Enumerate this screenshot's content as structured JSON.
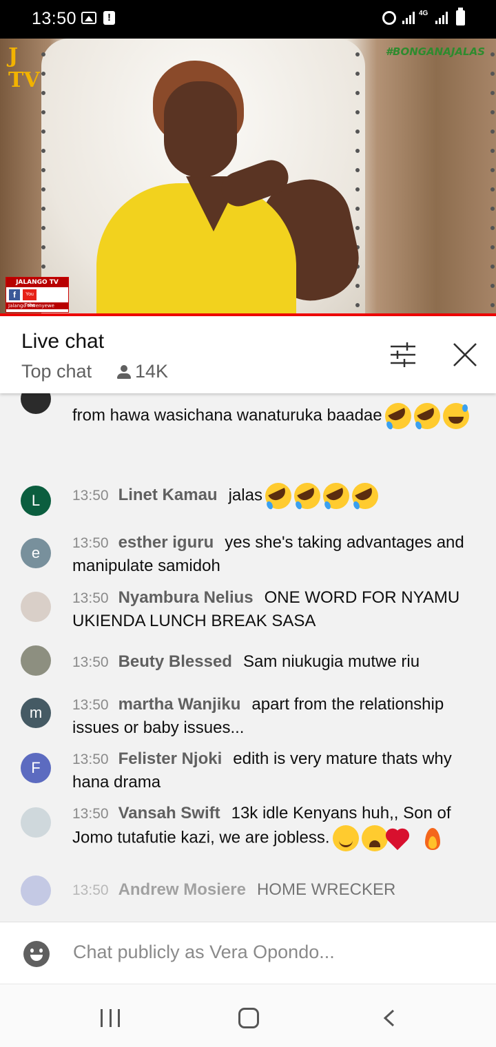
{
  "status_bar": {
    "time": "13:50",
    "network": "4G",
    "icons": [
      "image-icon",
      "alert-icon",
      "alarm-icon",
      "signal-icon",
      "battery-icon"
    ]
  },
  "video": {
    "hashtag": "#BONGANAJALAS",
    "channel_logo": "J TV",
    "badge_top": "JALANGO TV",
    "badge_bottom": "Jalango Mwenyewe",
    "badge_yt": "You Tube",
    "badge_fb": "f",
    "progress_fraction": 1.0,
    "progress_color": "#ee0000"
  },
  "chat_header": {
    "title": "Live chat",
    "mode": "Top chat",
    "viewer_count": "14K"
  },
  "messages": [
    {
      "time": "",
      "author": "",
      "text": "from hawa wasichana wanaturuka baadae",
      "emojis": [
        "rofl",
        "rofl",
        "sweat"
      ],
      "avatar_letter": "",
      "avatar_color": "#2b2b2b"
    },
    {
      "time": "13:50",
      "author": "Linet Kamau",
      "text": "jalas",
      "emojis": [
        "rofl",
        "rofl",
        "rofl",
        "rofl"
      ],
      "avatar_letter": "L",
      "avatar_color": "#0b5e3f"
    },
    {
      "time": "13:50",
      "author": "esther iguru",
      "text": "yes she's taking advantages and manipulate samidoh",
      "emojis": [],
      "avatar_letter": "e",
      "avatar_color": "#78909c"
    },
    {
      "time": "13:50",
      "author": "Nyambura Nelius",
      "text": "ONE WORD FOR NYAMU UKIENDA LUNCH BREAK SASA",
      "emojis": [],
      "avatar_letter": "",
      "avatar_color": "#d9cfc8"
    },
    {
      "time": "13:50",
      "author": "Beuty Blessed",
      "text": "Sam niukugia mutwe riu",
      "emojis": [],
      "avatar_letter": "",
      "avatar_color": "#8d8f80"
    },
    {
      "time": "13:50",
      "author": "martha Wanjiku",
      "text": "apart from the relationship issues or baby issues...",
      "emojis": [],
      "avatar_letter": "m",
      "avatar_color": "#455a64"
    },
    {
      "time": "13:50",
      "author": "Felister Njoki",
      "text": "edith is very mature thats why hana drama",
      "emojis": [],
      "avatar_letter": "F",
      "avatar_color": "#5c6bc0"
    },
    {
      "time": "13:50",
      "author": "Vansah Swift",
      "text": "13k idle Kenyans huh,, Son of Jomo tutafutie kazi, we are jobless.",
      "emojis": [
        "blush",
        "weary",
        "heart",
        "fire"
      ],
      "avatar_letter": "",
      "avatar_color": "#cfd8dc"
    },
    {
      "time": "13:50",
      "author": "Andrew Mosiere",
      "text": "HOME WRECKER",
      "emojis": [],
      "avatar_letter": "",
      "avatar_color": "#9fa8da"
    }
  ],
  "input": {
    "placeholder": "Chat publicly as Vera Opondo..."
  },
  "nav": {
    "recent": "recent-apps-icon",
    "home": "home-icon",
    "back": "back-icon"
  }
}
